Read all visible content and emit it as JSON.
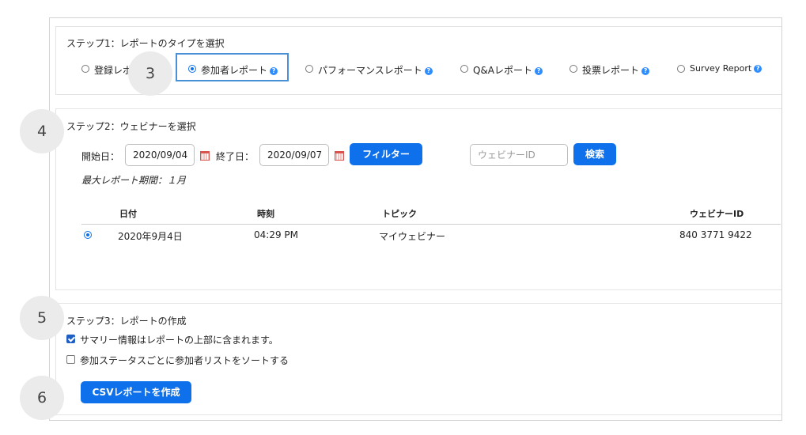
{
  "step1": {
    "title": "ステップ1：レポートのタイプを選択",
    "options": [
      {
        "label": "登録レポ",
        "selected": false,
        "help": false
      },
      {
        "label": "参加者レポート",
        "selected": true,
        "help": true
      },
      {
        "label": "パフォーマンスレポート",
        "selected": false,
        "help": true
      },
      {
        "label": "Q&Aレポート",
        "selected": false,
        "help": true
      },
      {
        "label": "投票レポート",
        "selected": false,
        "help": true
      },
      {
        "label": "Survey Report",
        "selected": false,
        "help": true
      }
    ]
  },
  "callouts": [
    "3",
    "4",
    "5",
    "6"
  ],
  "help_glyph": "?",
  "step2": {
    "title": "ステップ2：ウェビナーを選択",
    "start_label": "開始日：",
    "start_value": "2020/09/04",
    "end_label": "終了日：",
    "end_value": "2020/09/07",
    "filter_button": "フィルター",
    "webinar_id_placeholder": "ウェビナーID",
    "search_button": "検索",
    "max_period": "最大レポート期間：１月",
    "table": {
      "headers": [
        "日付",
        "時刻",
        "トピック",
        "ウェビナーID"
      ],
      "rows": [
        {
          "selected": true,
          "date": "2020年9月4日",
          "time": "04:29 PM",
          "topic": "マイウェビナー",
          "webinar_id": "840 3771 9422"
        }
      ]
    }
  },
  "step3": {
    "title": "ステップ3：レポートの作成",
    "checkboxes": [
      {
        "label": "サマリー情報はレポートの上部に含まれます。",
        "checked": true
      },
      {
        "label": "参加ステータスごとに参加者リストをソートする",
        "checked": false
      }
    ],
    "generate_button": "CSVレポートを作成"
  },
  "colors": {
    "accent": "#0e71eb",
    "help": "#2d8cff",
    "calendar": "#d9534f"
  }
}
